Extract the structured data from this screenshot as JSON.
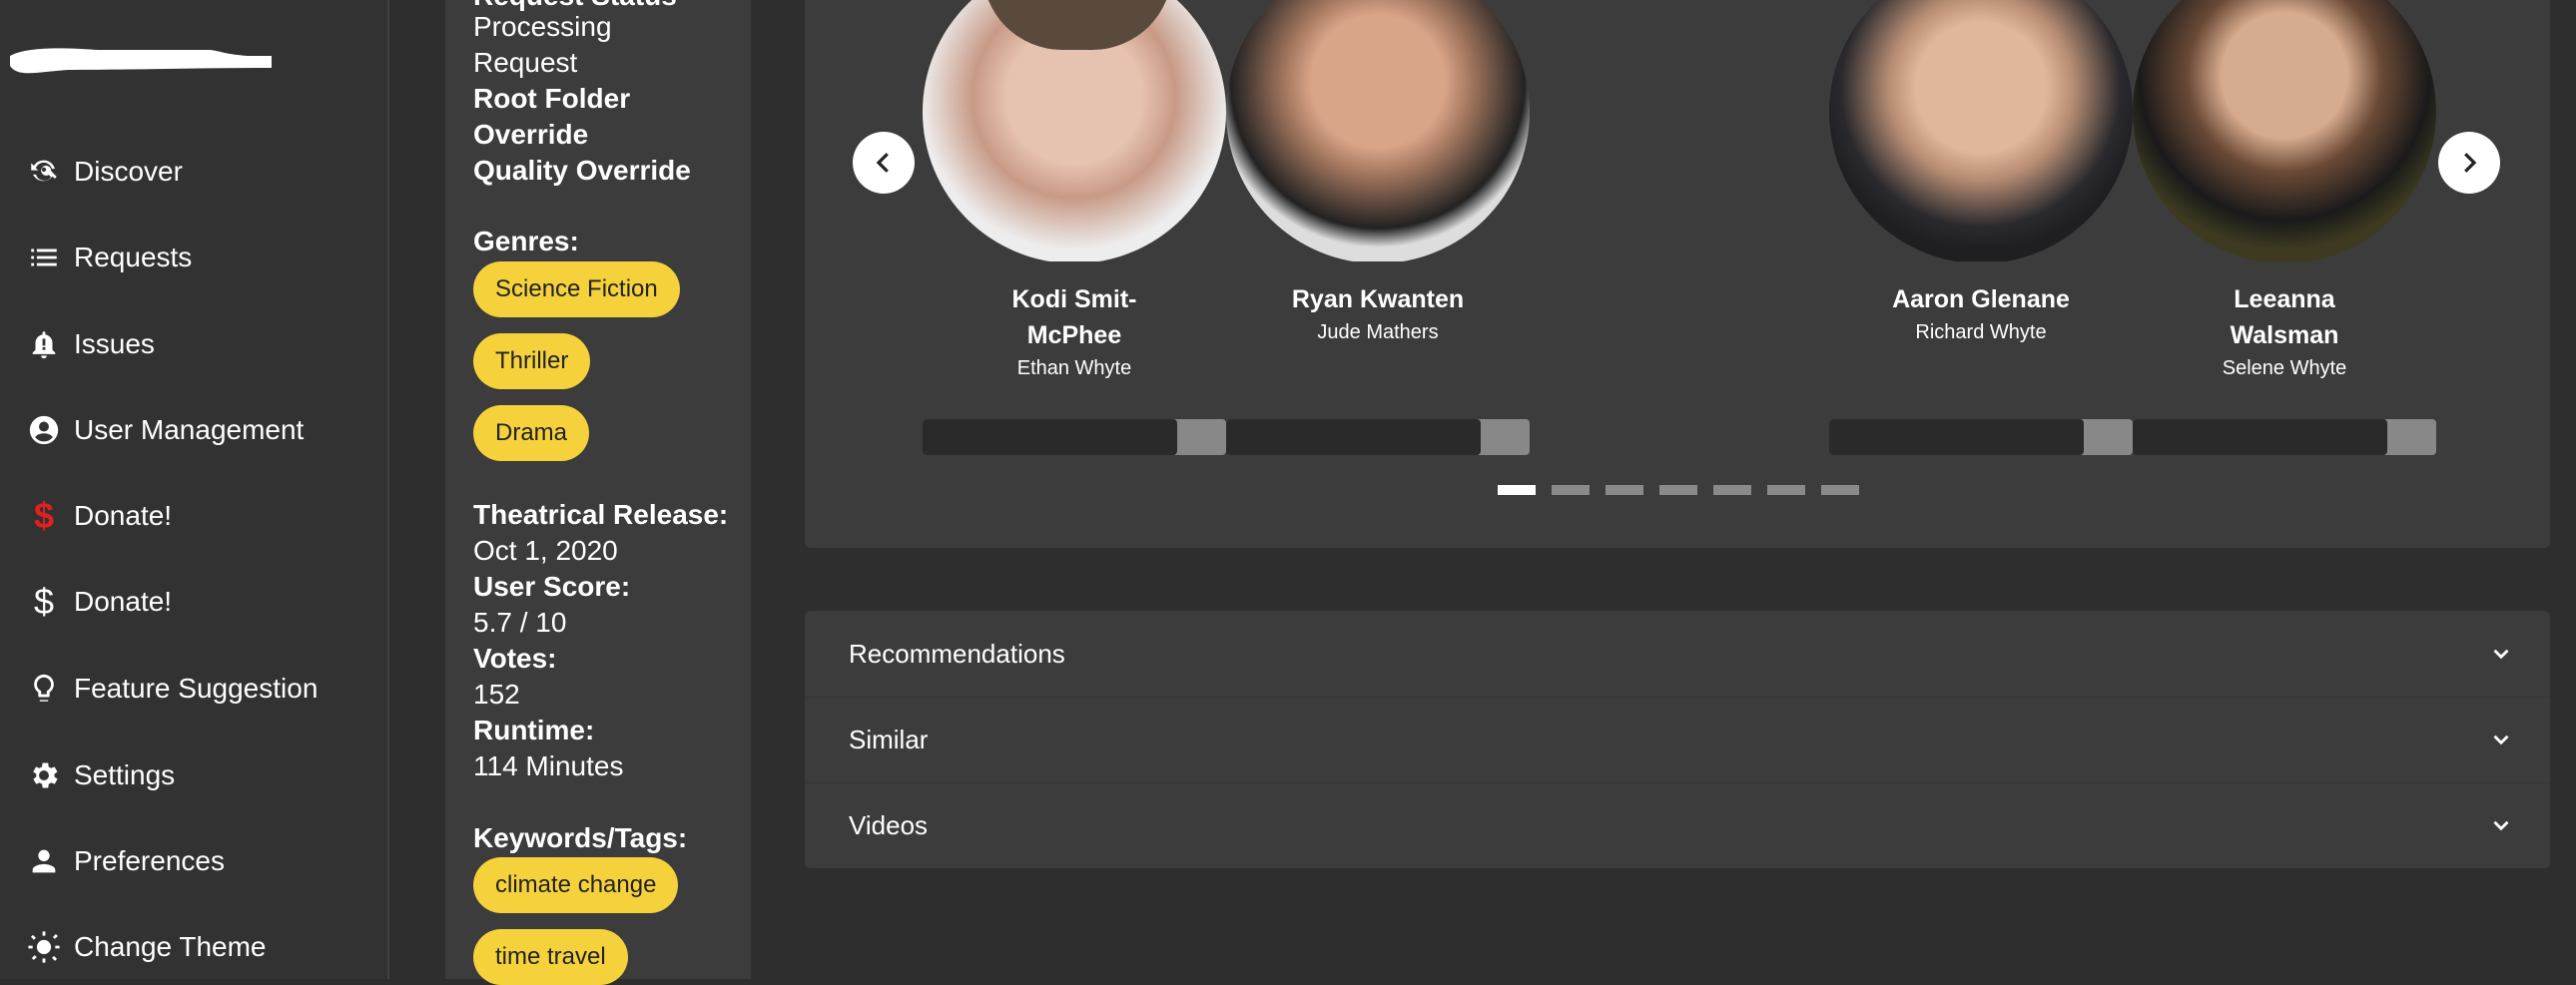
{
  "sidebar": {
    "items": [
      {
        "label": "Discover",
        "icon": "discover-icon"
      },
      {
        "label": "Requests",
        "icon": "list-icon"
      },
      {
        "label": "Issues",
        "icon": "bell-icon"
      },
      {
        "label": "User Management",
        "icon": "account-circle-icon"
      },
      {
        "label": "Donate!",
        "icon": "dollar-icon",
        "color": "#e02020"
      },
      {
        "label": "Donate!",
        "icon": "dollar-icon",
        "color": "#ffffff"
      },
      {
        "label": "Feature Suggestion",
        "icon": "lightbulb-icon"
      },
      {
        "label": "Settings",
        "icon": "gear-icon"
      },
      {
        "label": "Preferences",
        "icon": "person-icon"
      },
      {
        "label": "Change Theme",
        "icon": "brightness-icon"
      }
    ]
  },
  "info": {
    "request_status_label": "Request Status",
    "processing_line1": "Processing",
    "processing_line2": "Request",
    "root_folder_line1": "Root Folder",
    "root_folder_line2": "Override",
    "quality_override": "Quality Override",
    "genres_label": "Genres:",
    "genres": [
      "Science Fiction",
      "Thriller",
      "Drama"
    ],
    "theatrical_label": "Theatrical Release:",
    "theatrical_value": "Oct 1, 2020",
    "user_score_label": "User Score:",
    "user_score_value": "5.7 / 10",
    "votes_label": "Votes:",
    "votes_value": "152",
    "runtime_label": "Runtime:",
    "runtime_value": "114 Minutes",
    "keywords_label": "Keywords/Tags:",
    "keywords": [
      "climate change",
      "time travel"
    ]
  },
  "cast": [
    {
      "name_line1": "Kodi Smit-",
      "name_line2": "McPhee",
      "role": "Ethan Whyte",
      "bar_fraction": 0.84
    },
    {
      "name_line1": "Ryan Kwanten",
      "name_line2": "",
      "role": "Jude Mathers",
      "bar_fraction": 0.84
    },
    {
      "name_line1": "Aaron Glenane",
      "name_line2": "",
      "role": "Richard Whyte",
      "bar_fraction": 0.84
    },
    {
      "name_line1": "Leeanna",
      "name_line2": "Walsman",
      "role": "Selene Whyte",
      "bar_fraction": 0.84
    }
  ],
  "carousel": {
    "pages": 7,
    "active_page": 1
  },
  "accordion": {
    "items": [
      "Recommendations",
      "Similar",
      "Videos"
    ]
  },
  "colors": {
    "accent": "#f5d23b",
    "panel": "#3c3c3c",
    "background": "#2e2e2e"
  }
}
